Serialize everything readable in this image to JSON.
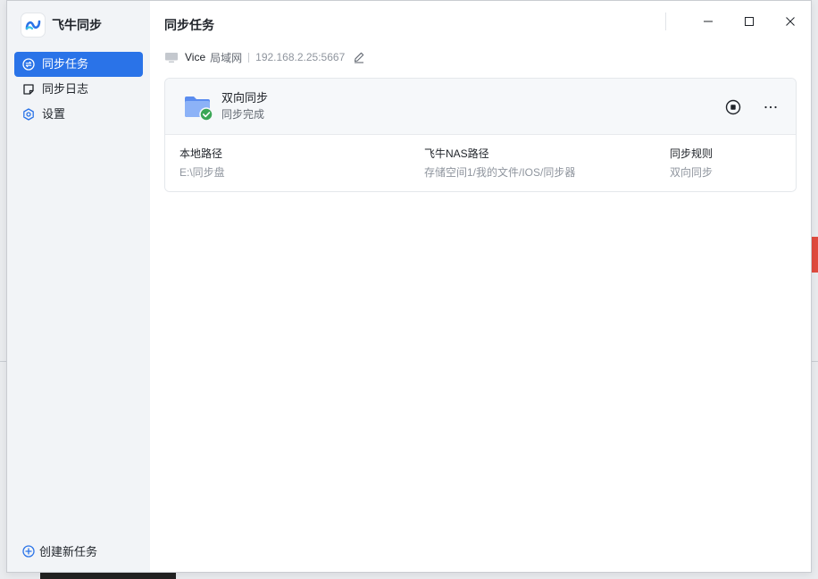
{
  "app": {
    "name": "飞牛同步"
  },
  "sidebar": {
    "items": [
      {
        "label": "同步任务",
        "icon": "sync-circle-icon",
        "active": true
      },
      {
        "label": "同步日志",
        "icon": "log-note-icon",
        "active": false
      },
      {
        "label": "设置",
        "icon": "gear-icon",
        "active": false
      }
    ],
    "create_label": "创建新任务"
  },
  "header": {
    "title": "同步任务"
  },
  "device": {
    "name": "Vice",
    "network": "局域网",
    "address": "192.168.2.25:5667"
  },
  "task": {
    "name": "双向同步",
    "status": "同步完成",
    "columns": [
      {
        "label": "本地路径",
        "value": "E:\\同步盘"
      },
      {
        "label": "飞牛NAS路径",
        "value": "存储空间1/我的文件/IOS/同步器"
      },
      {
        "label": "同步规则",
        "value": "双向同步"
      }
    ]
  },
  "colors": {
    "accent": "#2a73e8",
    "success": "#3aa655",
    "folder": "#6d9cf3"
  }
}
